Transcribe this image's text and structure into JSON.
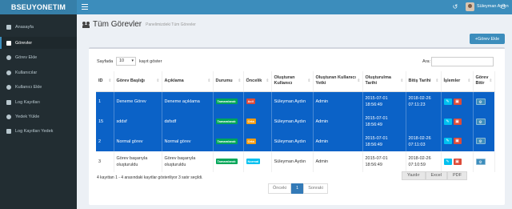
{
  "app": {
    "logo": "BSEUYONETIM"
  },
  "topbar": {
    "user_name": "Süleyman Aydın",
    "icons": [
      "menu-icon",
      "history-icon",
      "power-icon"
    ]
  },
  "sidebar": {
    "items": [
      {
        "label": "Anasayfa",
        "icon": "dashboard-icon"
      },
      {
        "label": "Görevler",
        "icon": "tasks-icon",
        "active": true
      },
      {
        "label": "Görev Ekle",
        "icon": "plus-circle-icon"
      },
      {
        "label": "Kullanıcılar",
        "icon": "users-icon"
      },
      {
        "label": "Kullanıcı Ekle",
        "icon": "plus-circle-icon"
      },
      {
        "label": "Log Kayıtları",
        "icon": "list-icon"
      },
      {
        "label": "Yedek Yükle",
        "icon": "upload-icon"
      },
      {
        "label": "Log Kayıtları Yedek",
        "icon": "list-icon"
      }
    ]
  },
  "page": {
    "title": "Tüm Görevler",
    "subtitle": "Panelimizdeki Tüm Görevler",
    "add_button": "+Görev Ekle"
  },
  "table_controls": {
    "length_label": "Sayfada",
    "length_value": "10",
    "length_suffix": "kayıt göster",
    "search_label": "Ara:",
    "search_value": ""
  },
  "table": {
    "headers": [
      "ID",
      "Görev Başlığı",
      "Açıklama",
      "Durumu",
      "Öncelik",
      "Oluşturan Kullanıcı",
      "Oluşturan Kullanıcı Yetki",
      "Oluşturulma Tarihi",
      "Bitiş Tarihi",
      "İşlemler",
      "Görev Bitir"
    ],
    "rows": [
      {
        "id": "1",
        "title": "Deneme Görev",
        "desc": "Deneme açıklama",
        "status": "Tamamlandı",
        "priority": "Acil",
        "user": "Süleyman Aydın",
        "role": "Admin",
        "created": "2015-07-01 18:56:49",
        "end": "2018-02-26 07:11:23",
        "selected": true
      },
      {
        "id": "15",
        "title": "sddsf",
        "desc": "dsfsdf",
        "status": "Tamamlandı",
        "priority": "Orta",
        "user": "Süleyman Aydın",
        "role": "Admin",
        "created": "2015-07-01 18:56:49",
        "end": "",
        "selected": true
      },
      {
        "id": "2",
        "title": "Normal görev",
        "desc": "Normal görev",
        "status": "Tamamlandı",
        "priority": "Orta",
        "user": "Süleyman Aydın",
        "role": "Admin",
        "created": "2015-07-01 18:56:49",
        "end": "2018-02-26 07:11:03",
        "selected": true
      },
      {
        "id": "3",
        "title": "Görev başarıyla oluşturuldu",
        "desc": "Görev başarıyla oluşturuldu",
        "status": "Tamamlandı",
        "priority": "Normal",
        "user": "Süleyman Aydın",
        "role": "Admin",
        "created": "2015-07-01 18:56:49",
        "end": "2018-02-26 07:10:59",
        "selected": false
      }
    ]
  },
  "footer": {
    "info": "4 kayıttan 1 - 4 arasındaki kayıtlar gösteriliyor   3 satır seçildi.",
    "export_buttons": [
      "Yazdır",
      "Excel",
      "PDF"
    ],
    "prev": "Önceki",
    "page": "1",
    "next": "Sonraki"
  },
  "colors": {
    "header_blue": "#3c8dbc",
    "logo_blue": "#367fa9",
    "sidebar": "#222d32",
    "selected_row": "#0b62c7"
  }
}
